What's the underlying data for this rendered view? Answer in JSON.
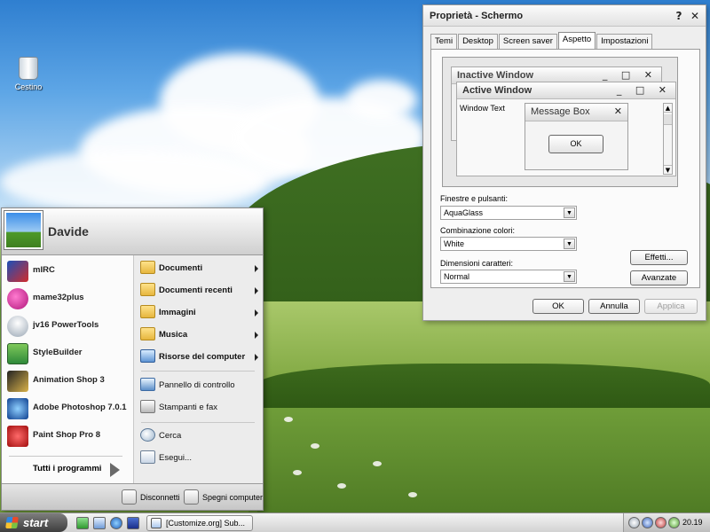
{
  "desktop": {
    "recycle_bin_label": "Cestino"
  },
  "dialog": {
    "title": "Proprietà - Schermo",
    "help_glyph": "?",
    "close_glyph": "✕",
    "tabs": [
      "Temi",
      "Desktop",
      "Screen saver",
      "Aspetto",
      "Impostazioni"
    ],
    "active_tab": "Aspetto",
    "preview": {
      "inactive_title": "Inactive Window",
      "active_title": "Active Window",
      "window_text": "Window Text",
      "message_box_title": "Message Box",
      "message_box_ok": "OK",
      "caption_buttons": "_ □ ✕"
    },
    "fields": {
      "windows_label": "Finestre e pulsanti:",
      "windows_value": "AquaGlass",
      "colors_label": "Combinazione colori:",
      "colors_value": "White",
      "fontsize_label": "Dimensioni caratteri:",
      "fontsize_value": "Normal"
    },
    "buttons": {
      "effects": "Effetti...",
      "advanced": "Avanzate",
      "ok": "OK",
      "cancel": "Annulla",
      "apply": "Applica"
    }
  },
  "start_menu": {
    "user": "Davide",
    "programs": [
      "mIRC",
      "mame32plus",
      "jv16 PowerTools",
      "StyleBuilder",
      "Animation Shop 3",
      "Adobe Photoshop 7.0.1",
      "Paint Shop Pro 8"
    ],
    "all_programs": "Tutti i programmi",
    "places": [
      "Documenti",
      "Documenti recenti",
      "Immagini",
      "Musica",
      "Risorse del computer"
    ],
    "system": [
      "Pannello di controllo",
      "Stampanti e fax"
    ],
    "tools": [
      "Cerca",
      "Esegui..."
    ],
    "footer": {
      "logoff": "Disconnetti",
      "shutdown": "Spegni computer"
    }
  },
  "taskbar": {
    "start": "start",
    "task_label": "[Customize.org] Sub...",
    "clock": "20.19"
  }
}
